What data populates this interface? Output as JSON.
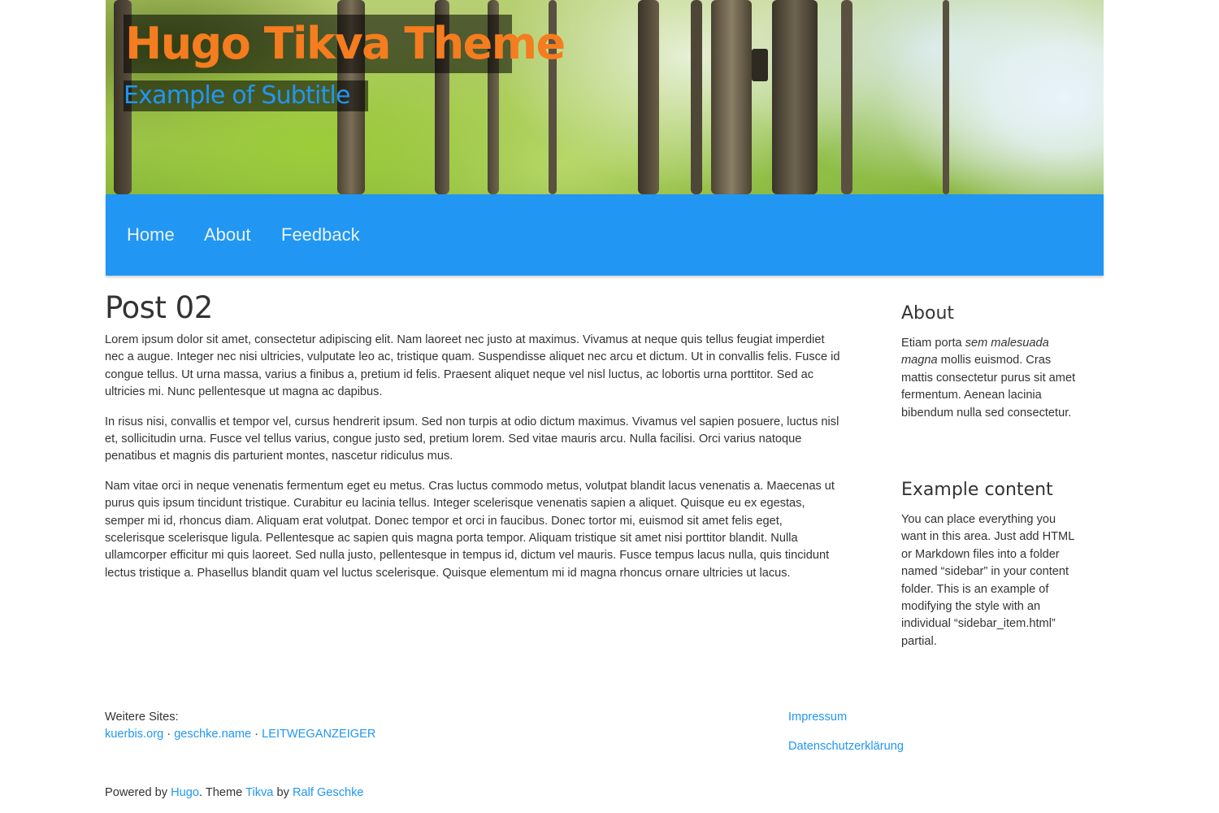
{
  "header": {
    "title": "Hugo Tikva Theme",
    "subtitle": "Example of Subtitle",
    "title_color": "#f57c1f",
    "subtitle_color": "#2196f3"
  },
  "nav": {
    "background": "#2196f3",
    "items": [
      {
        "label": "Home"
      },
      {
        "label": "About"
      },
      {
        "label": "Feedback"
      }
    ]
  },
  "post": {
    "title": "Post 02",
    "paragraphs": [
      "Lorem ipsum dolor sit amet, consectetur adipiscing elit. Nam laoreet nec justo at maximus. Vivamus at neque quis tellus feugiat imperdiet nec a augue. Integer nec nisi ultricies, vulputate leo ac, tristique quam. Suspendisse aliquet nec arcu et dictum. Ut in convallis felis. Fusce id congue tellus. Ut urna massa, varius a finibus a, pretium id felis. Praesent aliquet neque vel nisl luctus, ac lobortis urna porttitor. Sed ac ultricies mi. Nunc pellentesque ut magna ac dapibus.",
      "In risus nisi, convallis et tempor vel, cursus hendrerit ipsum. Sed non turpis at odio dictum maximus. Vivamus vel sapien posuere, luctus nisl et, sollicitudin urna. Fusce vel tellus varius, congue justo sed, pretium lorem. Sed vitae mauris arcu. Nulla facilisi. Orci varius natoque penatibus et magnis dis parturient montes, nascetur ridiculus mus.",
      "Nam vitae orci in neque venenatis fermentum eget eu metus. Cras luctus commodo metus, volutpat blandit lacus venenatis a. Maecenas ut purus quis ipsum tincidunt tristique. Curabitur eu lacinia tellus. Integer scelerisque venenatis sapien a aliquet. Quisque eu ex egestas, semper mi id, rhoncus diam. Aliquam erat volutpat. Donec tempor et orci in faucibus. Donec tortor mi, euismod sit amet felis eget, scelerisque scelerisque ligula. Pellentesque ac sapien quis magna porta tempor. Aliquam tristique sit amet nisi porttitor blandit. Nulla ullamcorper efficitur mi quis laoreet. Sed nulla justo, pellentesque in tempus id, dictum vel mauris. Fusce tempus lacus nulla, quis tincidunt lectus tristique a. Phasellus blandit quam vel luctus scelerisque. Quisque elementum mi id magna rhoncus ornare ultricies ut lacus."
    ]
  },
  "sidebar": {
    "about": {
      "heading": "About",
      "text_before": "Etiam porta ",
      "text_em": "sem malesuada magna",
      "text_after": " mollis euismod. Cras mattis consectetur purus sit amet fermentum. Aenean lacinia bibendum nulla sed consectetur."
    },
    "example": {
      "heading": "Example content",
      "text": "You can place everything you want in this area. Just add HTML or Markdown files into a folder named “sidebar” in your content folder. This is an example of modifying the style with an individual “sidebar_item.html” partial."
    }
  },
  "footer": {
    "sites_label": "Weitere Sites:",
    "sites": [
      "kuerbis.org",
      "geschke.name",
      "LEITWEGANZEIGER"
    ],
    "separator": " · ",
    "right_links": [
      "Impressum",
      "Datenschutzerklärung"
    ],
    "powered_by_prefix": "Powered by ",
    "powered_by_hugo": "Hugo",
    "theme_text": ". Theme ",
    "theme_name": "Tikva",
    "by_text": " by ",
    "author": "Ralf Geschke",
    "link_color": "#2196f3"
  }
}
